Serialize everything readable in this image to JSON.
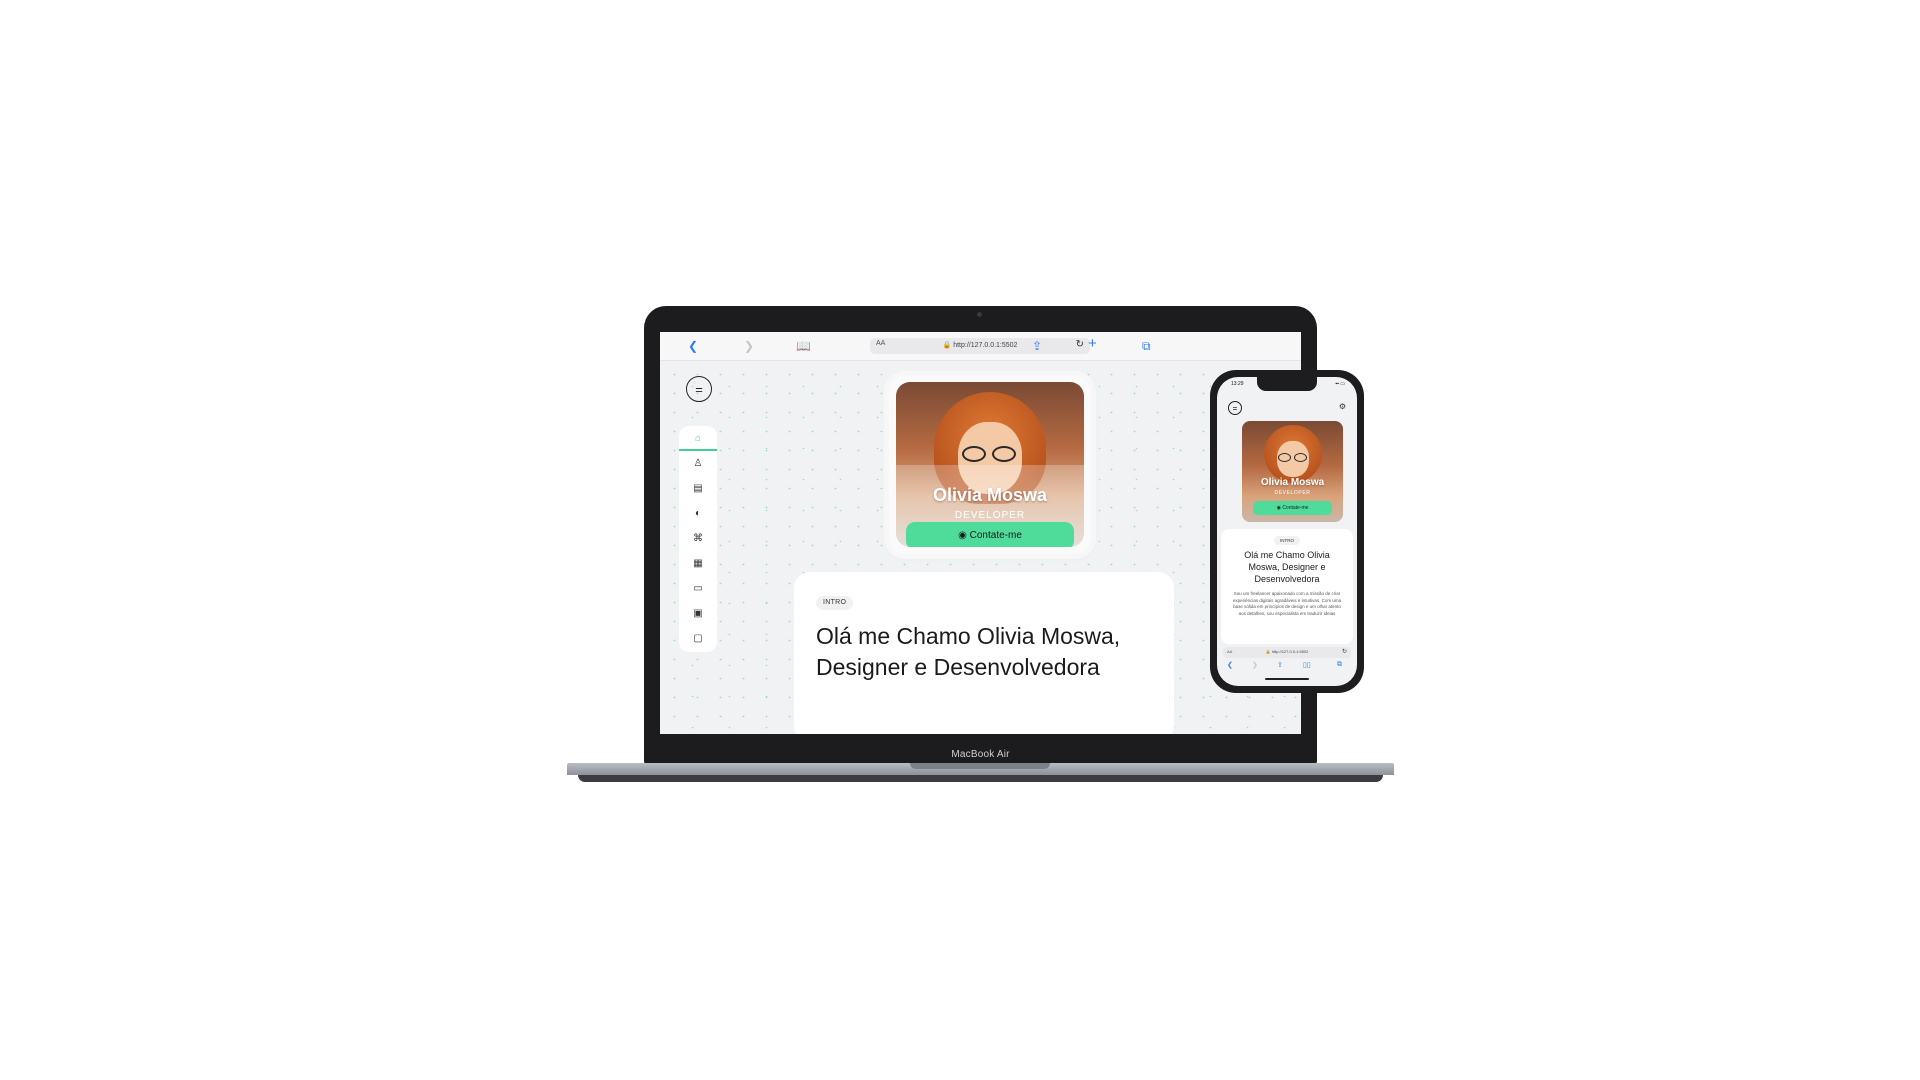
{
  "laptop": {
    "model_label": "MacBook Air",
    "browser": {
      "url": "http://127.0.0.1:5502",
      "text_size_label": "AA",
      "icons": {
        "back": "chevron-left-icon",
        "forward": "chevron-right-icon",
        "reader": "book-icon",
        "lock": "lock-icon",
        "reload": "reload-icon",
        "share": "share-icon",
        "new_tab": "plus-icon",
        "tabs": "tabs-icon"
      }
    },
    "page": {
      "menu_icon": "menu-icon",
      "sidebar": [
        {
          "name": "home",
          "icon": "home-icon",
          "glyph": "⌂",
          "active": true
        },
        {
          "name": "about",
          "icon": "user-icon",
          "glyph": "♙",
          "active": false
        },
        {
          "name": "portfolio",
          "icon": "briefcase-icon",
          "glyph": "▤",
          "active": false
        },
        {
          "name": "services",
          "icon": "toggle-icon",
          "glyph": "◐",
          "active": false
        },
        {
          "name": "skills",
          "icon": "translate-icon",
          "glyph": "⌘",
          "active": false
        },
        {
          "name": "experience",
          "icon": "grid-icon",
          "glyph": "▦",
          "active": false
        },
        {
          "name": "testimonials",
          "icon": "chat-icon",
          "glyph": "▭",
          "active": false
        },
        {
          "name": "blog",
          "icon": "document-icon",
          "glyph": "▣",
          "active": false
        },
        {
          "name": "contact",
          "icon": "contact-icon",
          "glyph": "▢",
          "active": false
        }
      ],
      "profile": {
        "name": "Olivia Moswa",
        "role": "DEVELOPER",
        "contact_button": "◉ Contate-me"
      },
      "intro": {
        "badge": "INTRO",
        "title": "Olá me Chamo Olivia Moswa, Designer e Desenvolvedora"
      }
    }
  },
  "phone": {
    "status_time": "13:29",
    "status_icons": "▪▪ ▭",
    "profile": {
      "name": "Olivia Moswa",
      "role": "DEVELOPER",
      "contact_button": "◉ Contate-me"
    },
    "intro": {
      "badge": "INTRO",
      "title": "Olá me Chamo Olivia Moswa, Designer e Desenvolvedora",
      "description": "Sou um freelancer apaixonado com a missão de criar experiências digitais agradáveis e intuitivas. Com uma base sólida em princípios de design e um olhar atento aos detalhes, sou especialista em traduzir ideias"
    },
    "url": "http://127.0.0.1:5502",
    "text_size_label": "AA"
  },
  "colors": {
    "accent": "#4fdc9b",
    "link_blue": "#2f7cf6",
    "page_bg": "#f1f2f3"
  }
}
